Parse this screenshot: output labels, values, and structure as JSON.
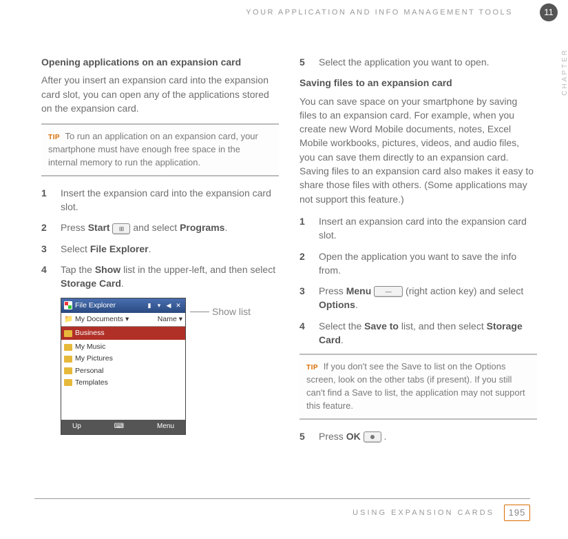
{
  "header": {
    "section_title": "YOUR APPLICATION AND INFO MANAGEMENT TOOLS",
    "chapter_number": "11",
    "chapter_label": "CHAPTER"
  },
  "left": {
    "heading": "Opening applications on an expansion card",
    "intro": "After you insert an expansion card into the expansion card slot, you can open any of the applications stored on the expansion card.",
    "tip_label": "TIP",
    "tip_text": "To run an application on an expansion card, your smartphone must have enough free space in the internal memory to run the application.",
    "steps": [
      {
        "pre": "Insert the expansion card into the expansion card slot."
      },
      {
        "pre": "Press ",
        "b1": "Start",
        "mid": " ",
        "icon": "start",
        "post": " and select ",
        "b2": "Programs",
        "end": "."
      },
      {
        "pre": "Select ",
        "b1": "File Explorer",
        "end": "."
      },
      {
        "pre": "Tap the ",
        "b1": "Show",
        "mid": " list in the upper-left, and then select ",
        "b2": "Storage Card",
        "end": "."
      }
    ],
    "fe": {
      "title": "File Explorer",
      "path_left": "My Documents",
      "path_right": "Name",
      "highlighted": "Business",
      "items": [
        "My Music",
        "My Pictures",
        "Personal",
        "Templates"
      ],
      "bottom_left": "Up",
      "bottom_right": "Menu",
      "callout": "Show list"
    }
  },
  "right": {
    "step5_top": {
      "num": "5",
      "pre": "Select the application you want to open."
    },
    "heading": "Saving files to an expansion card",
    "intro": "You can save space on your smartphone by saving files to an expansion card. For example, when you create new Word Mobile documents, notes, Excel Mobile workbooks, pictures, videos, and audio files, you can save them directly to an expansion card. Saving files to an expansion card also makes it easy to share those files with others. (Some applications may not support this feature.)",
    "steps": [
      {
        "pre": "Insert an expansion card into the expansion card slot."
      },
      {
        "pre": "Open the application you want to save the info from."
      },
      {
        "pre": "Press ",
        "b1": "Menu",
        "icon": "menu",
        "mid": " (right action key) and select ",
        "b2": "Options",
        "end": "."
      },
      {
        "pre": "Select the ",
        "b1": "Save to",
        "mid": " list, and then select ",
        "b2": "Storage Card",
        "end": "."
      }
    ],
    "tip_label": "TIP",
    "tip_text": "If you don't see the Save to list on the Options screen, look on the other tabs (if present). If you still can't find a Save to list, the application may not support this feature.",
    "step5_bottom": {
      "num": "5",
      "pre": "Press ",
      "b1": "OK",
      "icon": "ok",
      "end": " ."
    }
  },
  "footer": {
    "section": "USING EXPANSION CARDS",
    "page": "195"
  }
}
